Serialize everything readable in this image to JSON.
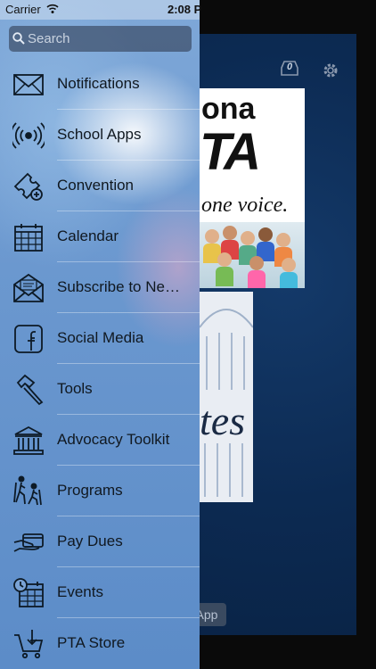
{
  "status_bar": {
    "carrier": "Carrier",
    "time": "2:08 P"
  },
  "search": {
    "placeholder": "Search"
  },
  "menu": {
    "items": [
      {
        "label": "Notifications",
        "icon": "envelope-icon"
      },
      {
        "label": "School Apps",
        "icon": "broadcast-icon"
      },
      {
        "label": "Convention",
        "icon": "ticket-icon"
      },
      {
        "label": "Calendar",
        "icon": "calendar-icon"
      },
      {
        "label": "Subscribe to Ne…",
        "icon": "open-envelope-icon"
      },
      {
        "label": "Social Media",
        "icon": "facebook-icon"
      },
      {
        "label": "Tools",
        "icon": "hammer-icon"
      },
      {
        "label": "Advocacy Toolkit",
        "icon": "government-building-icon"
      },
      {
        "label": "Programs",
        "icon": "hiking-people-icon"
      },
      {
        "label": "Pay Dues",
        "icon": "card-payment-icon"
      },
      {
        "label": "Events",
        "icon": "calendar-clock-icon"
      },
      {
        "label": "PTA Store",
        "icon": "shopping-cart-icon"
      }
    ]
  },
  "background": {
    "inbox_count": "0",
    "logo_text": "ona",
    "logo_pta": "TA",
    "logo_tagline": "one voice.",
    "capitol_text": "tes",
    "app_button": "App"
  }
}
